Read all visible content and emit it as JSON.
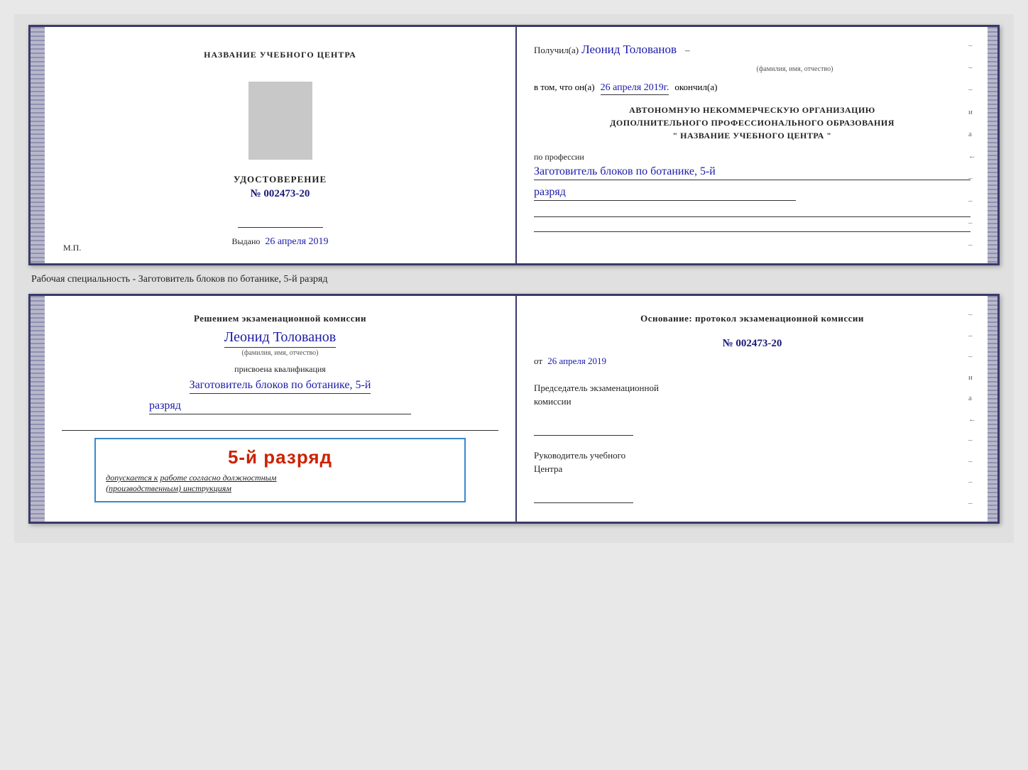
{
  "top_document": {
    "left": {
      "title": "НАЗВАНИЕ УЧЕБНОГО ЦЕНТРА",
      "cert_label": "УДОСТОВЕРЕНИЕ",
      "cert_number": "№ 002473-20",
      "issued_label": "Выдано",
      "issued_date": "26 апреля 2019",
      "mp_label": "М.П."
    },
    "right": {
      "received_label": "Получил(а)",
      "recipient_name": "Леонид Толованов",
      "fio_label": "(фамилия, имя, отчество)",
      "confirmed_label": "в том, что он(а)",
      "confirmed_date": "26 апреля 2019г.",
      "finished_label": "окончил(а)",
      "org_line1": "АВТОНОМНУЮ НЕКОММЕРЧЕСКУЮ ОРГАНИЗАЦИЮ",
      "org_line2": "ДОПОЛНИТЕЛЬНОГО ПРОФЕССИОНАЛЬНОГО ОБРАЗОВАНИЯ",
      "org_line3": "\"  НАЗВАНИЕ УЧЕБНОГО ЦЕНТРА  \"",
      "profession_label": "по профессии",
      "profession_value": "Заготовитель блоков по ботанике, 5-й",
      "rank_value": "разряд",
      "right_marks": [
        "–",
        "–",
        "–",
        "и",
        "а",
        "←",
        "–",
        "–",
        "–",
        "–"
      ]
    }
  },
  "specialty_line": "Рабочая специальность - Заготовитель блоков по ботанике, 5-й разряд",
  "bottom_document": {
    "left": {
      "decision_text": "Решением экзаменационной комиссии",
      "name": "Леонид Толованов",
      "fio_label": "(фамилия, имя, отчество)",
      "qualification_label": "присвоена квалификация",
      "qualification_value": "Заготовитель блоков по ботанике, 5-й",
      "rank_value": "разряд",
      "stamp_rank": "5-й разряд",
      "admitted_text": "допускается к",
      "admitted_underline": "работе согласно должностным",
      "admitted_italic": "(производственным) инструкциям"
    },
    "right": {
      "basis_label": "Основание: протокол экзаменационной комиссии",
      "protocol_number": "№ 002473-20",
      "from_label": "от",
      "from_date": "26 апреля 2019",
      "chairman_title": "Председатель экзаменационной",
      "chairman_title2": "комиссии",
      "head_title": "Руководитель учебного",
      "head_title2": "Центра",
      "right_marks": [
        "–",
        "–",
        "–",
        "и",
        "а",
        "←",
        "–",
        "–",
        "–",
        "–"
      ]
    }
  }
}
